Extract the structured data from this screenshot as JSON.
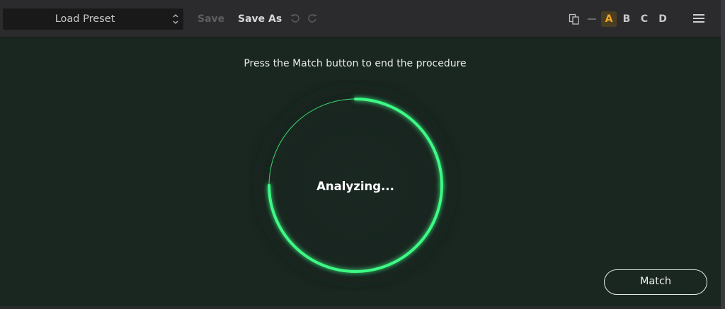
{
  "toolbar": {
    "preset_label": "Load Preset",
    "save_label": "Save",
    "save_as_label": "Save As",
    "slots": [
      "A",
      "B",
      "C",
      "D"
    ],
    "active_slot": "A"
  },
  "main": {
    "instruction": "Press the Match button to end the procedure",
    "status": "Analyzing...",
    "match_label": "Match"
  },
  "colors": {
    "background": "#1a2620",
    "toolbar": "#2b2b2e",
    "accent_ring": "#3dfa85",
    "active_slot": "#f5a623"
  },
  "icons": {
    "undo": "undo-icon",
    "redo": "redo-icon",
    "copy": "copy-icon",
    "menu": "hamburger-menu-icon",
    "select": "chevron-up-down-icon"
  }
}
